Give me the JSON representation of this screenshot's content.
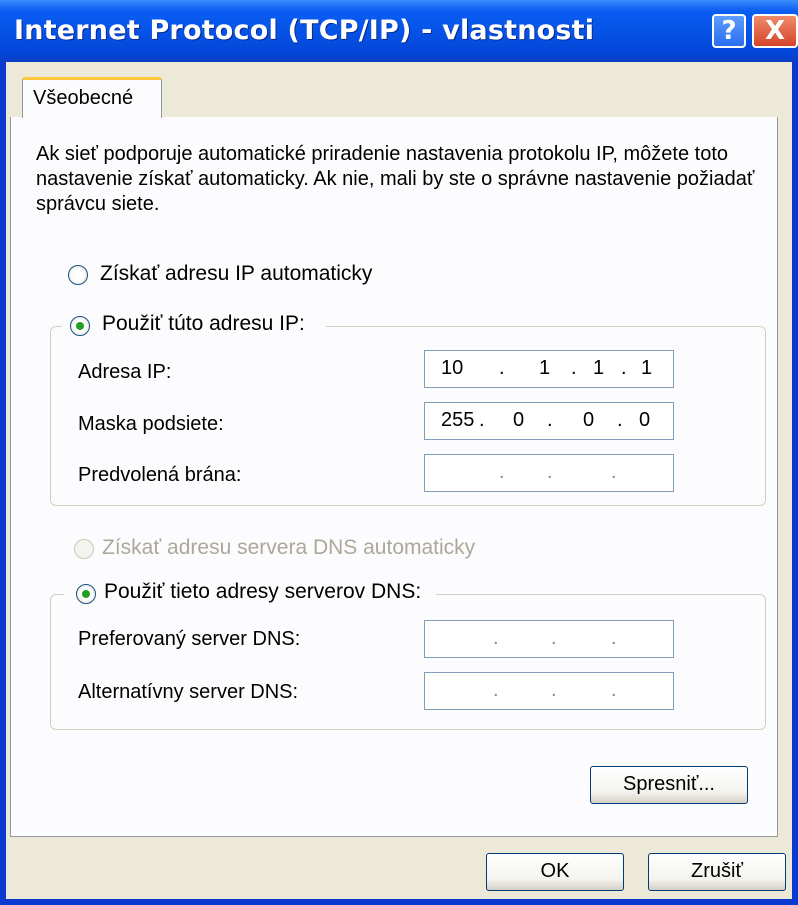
{
  "window": {
    "title": "Internet Protocol (TCP/IP) - vlastnosti",
    "help_glyph": "?",
    "close_glyph": "X"
  },
  "tabs": [
    {
      "label": "Všeobecné",
      "selected": true
    }
  ],
  "intro": "Ak sieť podporuje automatické priradenie nastavenia protokolu IP, môžete toto nastavenie získať automaticky. Ak nie, mali by ste o správne nastavenie požiadať správcu siete.",
  "ip_mode": {
    "auto_label": "Získať adresu IP automaticky",
    "auto_selected": false,
    "manual_label": "Použiť túto adresu IP:",
    "manual_selected": true
  },
  "ip_fields": [
    {
      "label": "Adresa IP:",
      "octets": [
        "10",
        "1",
        "1",
        "1"
      ]
    },
    {
      "label": "Maska podsiete:",
      "octets": [
        "255",
        "0",
        "0",
        "0"
      ]
    },
    {
      "label": "Predvolená brána:",
      "octets": [
        "",
        "",
        "",
        ""
      ]
    }
  ],
  "dns_mode": {
    "auto_label": "Získať adresu servera DNS automaticky",
    "auto_selected": false,
    "auto_disabled": true,
    "manual_label": "Použiť tieto adresy serverov DNS:",
    "manual_selected": true
  },
  "dns_fields": [
    {
      "label": "Preferovaný server DNS:",
      "octets": [
        "",
        "",
        "",
        ""
      ]
    },
    {
      "label": "Alternatívny server DNS:",
      "octets": [
        "",
        "",
        "",
        ""
      ]
    }
  ],
  "buttons": {
    "advanced": "Spresniť...",
    "ok": "OK",
    "cancel": "Zrušiť"
  },
  "colors": {
    "titlebar": "#0651e6",
    "window_bg": "#ece9d8",
    "panel_bg": "#fcfcfe",
    "tab_accent": "#ffc83c",
    "radio_dot": "#21a121"
  }
}
